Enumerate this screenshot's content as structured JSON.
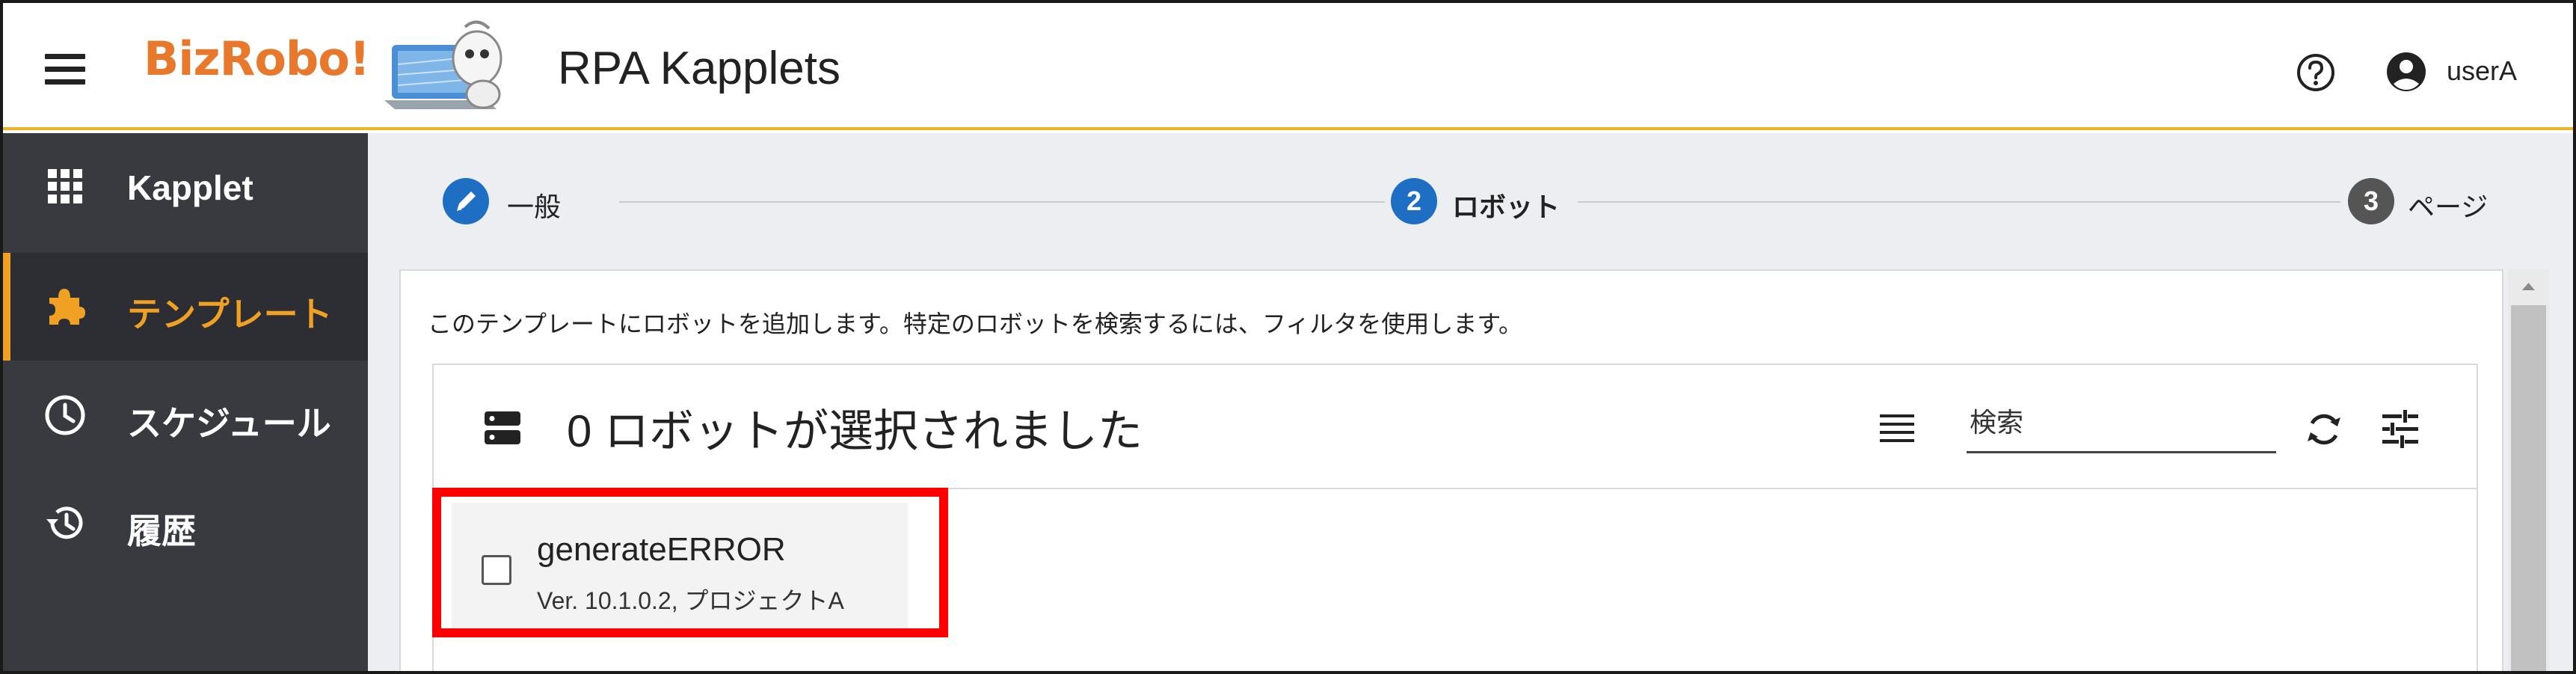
{
  "header": {
    "logo_text": "BizRobo!",
    "title": "RPA Kapplets",
    "user": "userA",
    "icons": {
      "menu": "hamburger-menu-icon",
      "help": "help-circle-icon",
      "user": "account-circle-icon"
    }
  },
  "sidebar": {
    "items": [
      {
        "label": "Kapplet",
        "icon": "grid-icon",
        "active": false
      },
      {
        "label": "テンプレート",
        "icon": "puzzle-icon",
        "active": true
      },
      {
        "label": "スケジュール",
        "icon": "clock-icon",
        "active": false
      },
      {
        "label": "履歴",
        "icon": "history-icon",
        "active": false
      }
    ],
    "active_color": "#f0a023"
  },
  "stepper": {
    "steps": [
      {
        "number": "",
        "label": "一般",
        "state": "done",
        "icon": "pencil-icon"
      },
      {
        "number": "2",
        "label": "ロボット",
        "state": "active"
      },
      {
        "number": "3",
        "label": "ページ",
        "state": "pending"
      }
    ],
    "active_color": "#1e6fc4",
    "pending_color": "#555555"
  },
  "card": {
    "description": "このテンプレートにロボットを追加します。特定のロボットを検索するには、フィルタを使用します。",
    "selection_count": "0 ロボットが選択されました",
    "search": {
      "placeholder": "検索",
      "value": ""
    },
    "icons": {
      "header": "database-icon",
      "view": "list-view-icon",
      "refresh": "refresh-icon",
      "filter": "tune-icon"
    },
    "robots": [
      {
        "name": "generateERROR",
        "meta": "Ver. 10.1.0.2, プロジェクトA",
        "checked": false
      }
    ]
  },
  "highlight_color": "#ff0000"
}
